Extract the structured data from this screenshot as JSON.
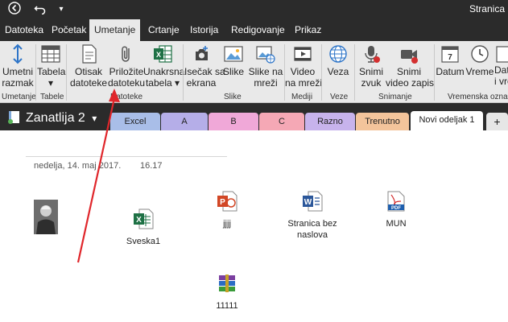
{
  "window": {
    "title": "Stranica"
  },
  "menu": {
    "tabs": [
      "Datoteka",
      "Početak",
      "Umetanje",
      "Crtanje",
      "Istorija",
      "Redigovanje",
      "Prikaz"
    ]
  },
  "ribbon": {
    "umetni_razmak": [
      "Umetni",
      "razmak"
    ],
    "tabela": [
      "Tabela",
      "▾"
    ],
    "otisak_datoteke": [
      "Otisak",
      "datoteke"
    ],
    "prilozite_datoteku": [
      "Priložite",
      "datoteku"
    ],
    "unakrsna_tabela": [
      "Unakrsna",
      "tabela ▾"
    ],
    "isecak_sa_ekrana": [
      "Isečak sa",
      "ekrana"
    ],
    "slike": [
      "Slike",
      ""
    ],
    "slike_na_mrezi": [
      "Slike na",
      "mreži"
    ],
    "video_na_mrezi": [
      "Video",
      "na mreži"
    ],
    "veza": [
      "Veza",
      ""
    ],
    "snimi_zvuk": [
      "Snimi",
      "zvuk"
    ],
    "snimi_video_zapis": [
      "Snimi",
      "video zapis"
    ],
    "datum": [
      "Datum",
      ""
    ],
    "vreme": [
      "Vreme",
      ""
    ],
    "datum_i_vreme": [
      "Datum",
      "i vre"
    ],
    "groups": {
      "umetanje": "Umetanje",
      "tabele": "Tabele",
      "datoteke": "Datoteke",
      "slike": "Slike",
      "mediji": "Mediji",
      "veze": "Veze",
      "snimanje": "Snimanje",
      "vremenska": "Vremenska ozna"
    }
  },
  "notebook": {
    "title": "Zanatlija 2",
    "sections": [
      {
        "label": "Excel",
        "color": "#a9bee8"
      },
      {
        "label": "A",
        "color": "#b5aee8"
      },
      {
        "label": "B",
        "color": "#f0a8d8"
      },
      {
        "label": "C",
        "color": "#f5a8b5"
      },
      {
        "label": "Razno",
        "color": "#c7b3ec"
      },
      {
        "label": "Trenutno",
        "color": "#f3c49b"
      },
      {
        "label": "Novi odeljak 1",
        "color": "#ffffff"
      },
      {
        "label": "+",
        "color": "#e6e6e6"
      }
    ]
  },
  "page": {
    "date": "nedelja, 14. maj 2017.",
    "time": "16.17",
    "files": [
      {
        "name": "Sveska1",
        "type": "excel"
      },
      {
        "name": "jjjj",
        "type": "powerpoint"
      },
      {
        "name": "Stranica bez naslova",
        "type": "word"
      },
      {
        "name": "MUN",
        "type": "pdf"
      },
      {
        "name": "11111",
        "type": "archive"
      }
    ]
  },
  "colors": {
    "dark": "#2b2b2b",
    "ribbon": "#e9e9e9",
    "arrow": "#e0262b"
  }
}
